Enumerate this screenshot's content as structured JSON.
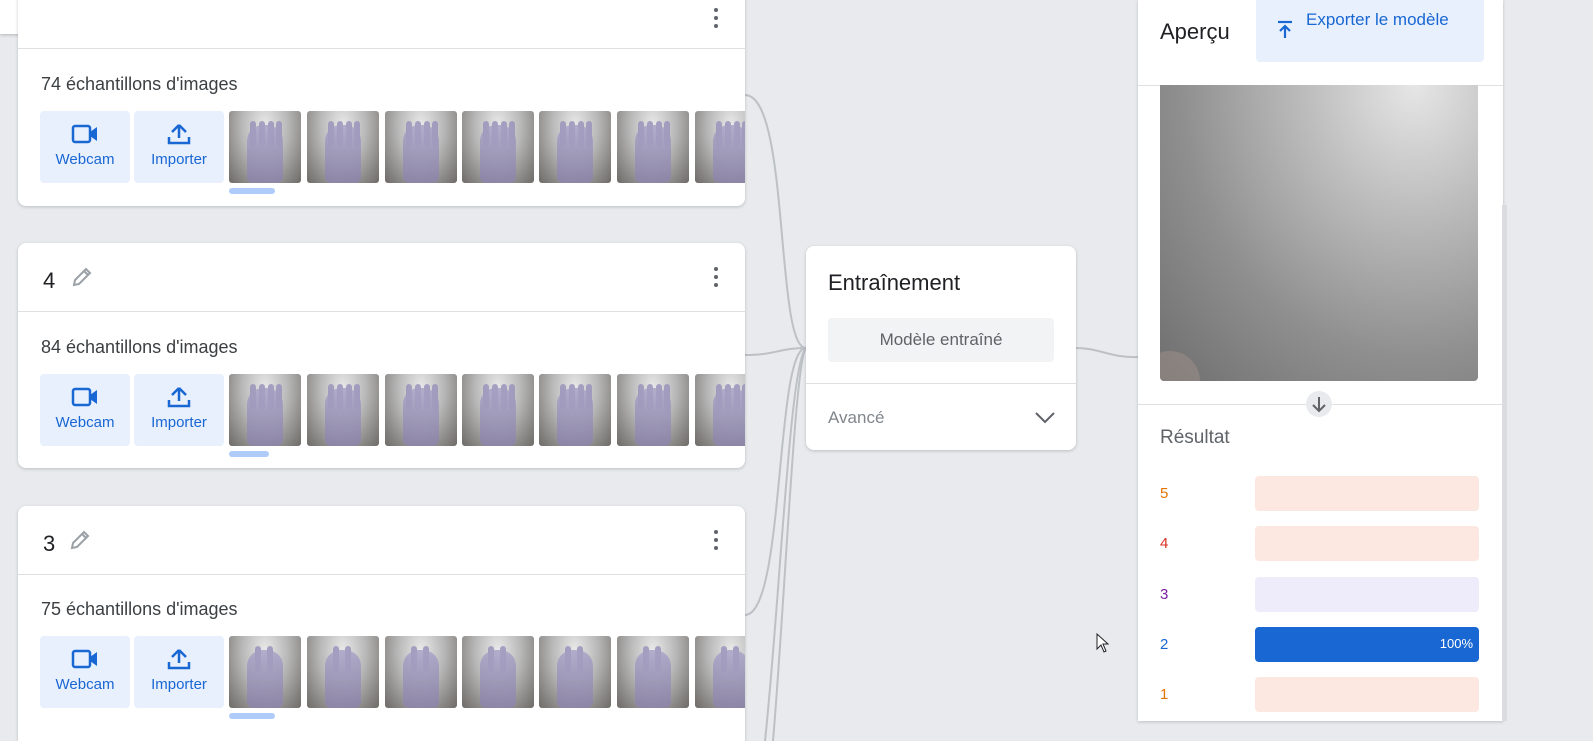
{
  "classes": [
    {
      "name": "",
      "samples": "74 échantillons d'images",
      "webcam": "Webcam",
      "upload": "Importer"
    },
    {
      "name": "4",
      "samples": "84 échantillons d'images",
      "webcam": "Webcam",
      "upload": "Importer"
    },
    {
      "name": "3",
      "samples": "75 échantillons d'images",
      "webcam": "Webcam",
      "upload": "Importer"
    }
  ],
  "training": {
    "title": "Entraînement",
    "trained_button": "Modèle entraîné",
    "advanced": "Avancé"
  },
  "preview": {
    "title": "Aperçu",
    "export_button": "Exporter le modèle",
    "output_title": "Résultat",
    "results": [
      {
        "label": "5",
        "color": "#e37400",
        "track": "#fce8e0",
        "percent": 0,
        "value": ""
      },
      {
        "label": "4",
        "color": "#d93025",
        "track": "#fce8e0",
        "percent": 0,
        "value": ""
      },
      {
        "label": "3",
        "color": "#7b1fa2",
        "track": "#eeecfb",
        "percent": 0,
        "value": ""
      },
      {
        "label": "2",
        "color": "#1967d2",
        "track": "#e8f0fe",
        "percent": 100,
        "value": "100%"
      },
      {
        "label": "1",
        "color": "#e37400",
        "track": "#fce8e0",
        "percent": 0,
        "value": ""
      }
    ]
  },
  "icons": [
    "edit-icon",
    "more-vert-icon",
    "webcam-icon",
    "upload-icon",
    "chevron-down-icon",
    "export-icon",
    "arrow-down-icon",
    "mouse-cursor-icon"
  ],
  "colors": {
    "accent": "#1967d2",
    "tile_bg": "#e8f0fe",
    "canvas_bg": "#e8eaed"
  }
}
